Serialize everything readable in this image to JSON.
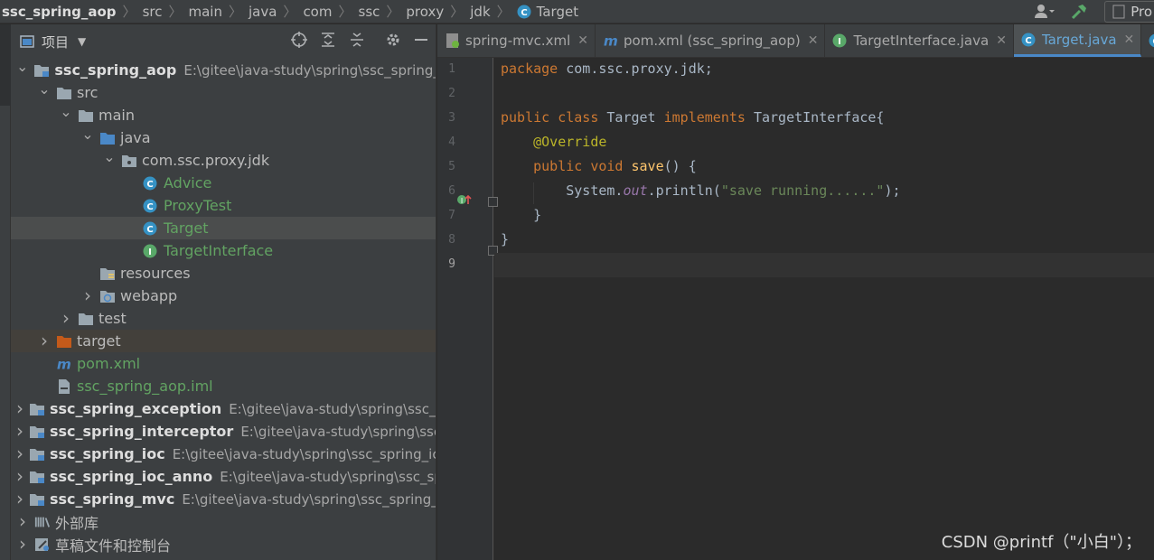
{
  "breadcrumb": {
    "items": [
      "ssc_spring_aop",
      "src",
      "main",
      "java",
      "com",
      "ssc",
      "proxy",
      "jdk",
      "Target"
    ],
    "right_label": "Pro"
  },
  "left_strip": {
    "label": "项目"
  },
  "project": {
    "title": "项目",
    "tree": [
      {
        "label": "ssc_spring_aop",
        "path": "E:\\gitee\\java-study\\spring\\ssc_spring_",
        "depth": 0,
        "arrow": "down",
        "icon": "module-folder-icon",
        "bold": true
      },
      {
        "label": "src",
        "depth": 1,
        "arrow": "down",
        "icon": "folder-icon"
      },
      {
        "label": "main",
        "depth": 2,
        "arrow": "down",
        "icon": "folder-icon"
      },
      {
        "label": "java",
        "depth": 3,
        "arrow": "down",
        "icon": "source-folder-icon"
      },
      {
        "label": "com.ssc.proxy.jdk",
        "depth": 4,
        "arrow": "down",
        "icon": "package-icon"
      },
      {
        "label": "Advice",
        "depth": 5,
        "icon": "class-icon",
        "green": true
      },
      {
        "label": "ProxyTest",
        "depth": 5,
        "icon": "class-icon",
        "green": true
      },
      {
        "label": "Target",
        "depth": 5,
        "icon": "class-icon",
        "green": true,
        "selected": true
      },
      {
        "label": "TargetInterface",
        "depth": 5,
        "icon": "interface-icon",
        "green": true
      },
      {
        "label": "resources",
        "depth": 3,
        "icon": "resources-folder-icon"
      },
      {
        "label": "webapp",
        "depth": 3,
        "arrow": "right",
        "icon": "web-folder-icon"
      },
      {
        "label": "test",
        "depth": 2,
        "arrow": "right",
        "icon": "folder-icon"
      },
      {
        "label": "target",
        "depth": 1,
        "arrow": "right",
        "icon": "excluded-folder-icon",
        "target": true
      },
      {
        "label": "pom.xml",
        "depth": 1,
        "icon": "maven-icon",
        "green": true
      },
      {
        "label": "ssc_spring_aop.iml",
        "depth": 1,
        "icon": "iml-file-icon",
        "green": true
      },
      {
        "label": "ssc_spring_exception",
        "path": "E:\\gitee\\java-study\\spring\\ssc_s",
        "depth": 0,
        "arrow": "right",
        "icon": "module-folder-icon",
        "bold": true
      },
      {
        "label": "ssc_spring_interceptor",
        "path": "E:\\gitee\\java-study\\spring\\ssc_",
        "depth": 0,
        "arrow": "right",
        "icon": "module-folder-icon",
        "bold": true
      },
      {
        "label": "ssc_spring_ioc",
        "path": "E:\\gitee\\java-study\\spring\\ssc_spring_ic",
        "depth": 0,
        "arrow": "right",
        "icon": "module-folder-icon",
        "bold": true
      },
      {
        "label": "ssc_spring_ioc_anno",
        "path": "E:\\gitee\\java-study\\spring\\ssc_sp",
        "depth": 0,
        "arrow": "right",
        "icon": "module-folder-icon",
        "bold": true
      },
      {
        "label": "ssc_spring_mvc",
        "path": "E:\\gitee\\java-study\\spring\\ssc_spring_",
        "depth": 0,
        "arrow": "right",
        "icon": "module-folder-icon",
        "bold": true
      },
      {
        "label": "外部库",
        "depth": 0,
        "arrow": "right",
        "icon": "library-icon"
      },
      {
        "label": "草稿文件和控制台",
        "depth": 0,
        "arrow": "right",
        "icon": "scratch-icon"
      }
    ]
  },
  "editor": {
    "tabs": [
      {
        "label": "spring-mvc.xml",
        "icon": "spring-xml-icon",
        "active": false
      },
      {
        "label": "pom.xml (ssc_spring_aop)",
        "icon": "maven-icon",
        "active": false
      },
      {
        "label": "TargetInterface.java",
        "icon": "interface-icon",
        "active": false
      },
      {
        "label": "Target.java",
        "icon": "class-icon",
        "active": true
      },
      {
        "label": "",
        "icon": "class-icon",
        "active": false
      }
    ],
    "line_numbers": [
      "1",
      "2",
      "3",
      "4",
      "5",
      "6",
      "7",
      "8",
      "9"
    ],
    "code": {
      "l1_kw": "package",
      "l1_rest": " com.ssc.proxy.jdk;",
      "l3_kw1": "public",
      "l3_kw2": "class",
      "l3_name": "Target",
      "l3_kw3": "implements",
      "l3_iface": "TargetInterface{",
      "l4_ann": "@Override",
      "l5_kw1": "public",
      "l5_kw2": "void",
      "l5_fn": "save",
      "l5_rest": "() {",
      "l6_a": "System.",
      "l6_out": "out",
      "l6_b": ".println(",
      "l6_str": "\"save running......\"",
      "l6_c": ");",
      "l7": "}",
      "l8": "}"
    }
  },
  "watermark": "CSDN @printf（\"小白\"）；"
}
